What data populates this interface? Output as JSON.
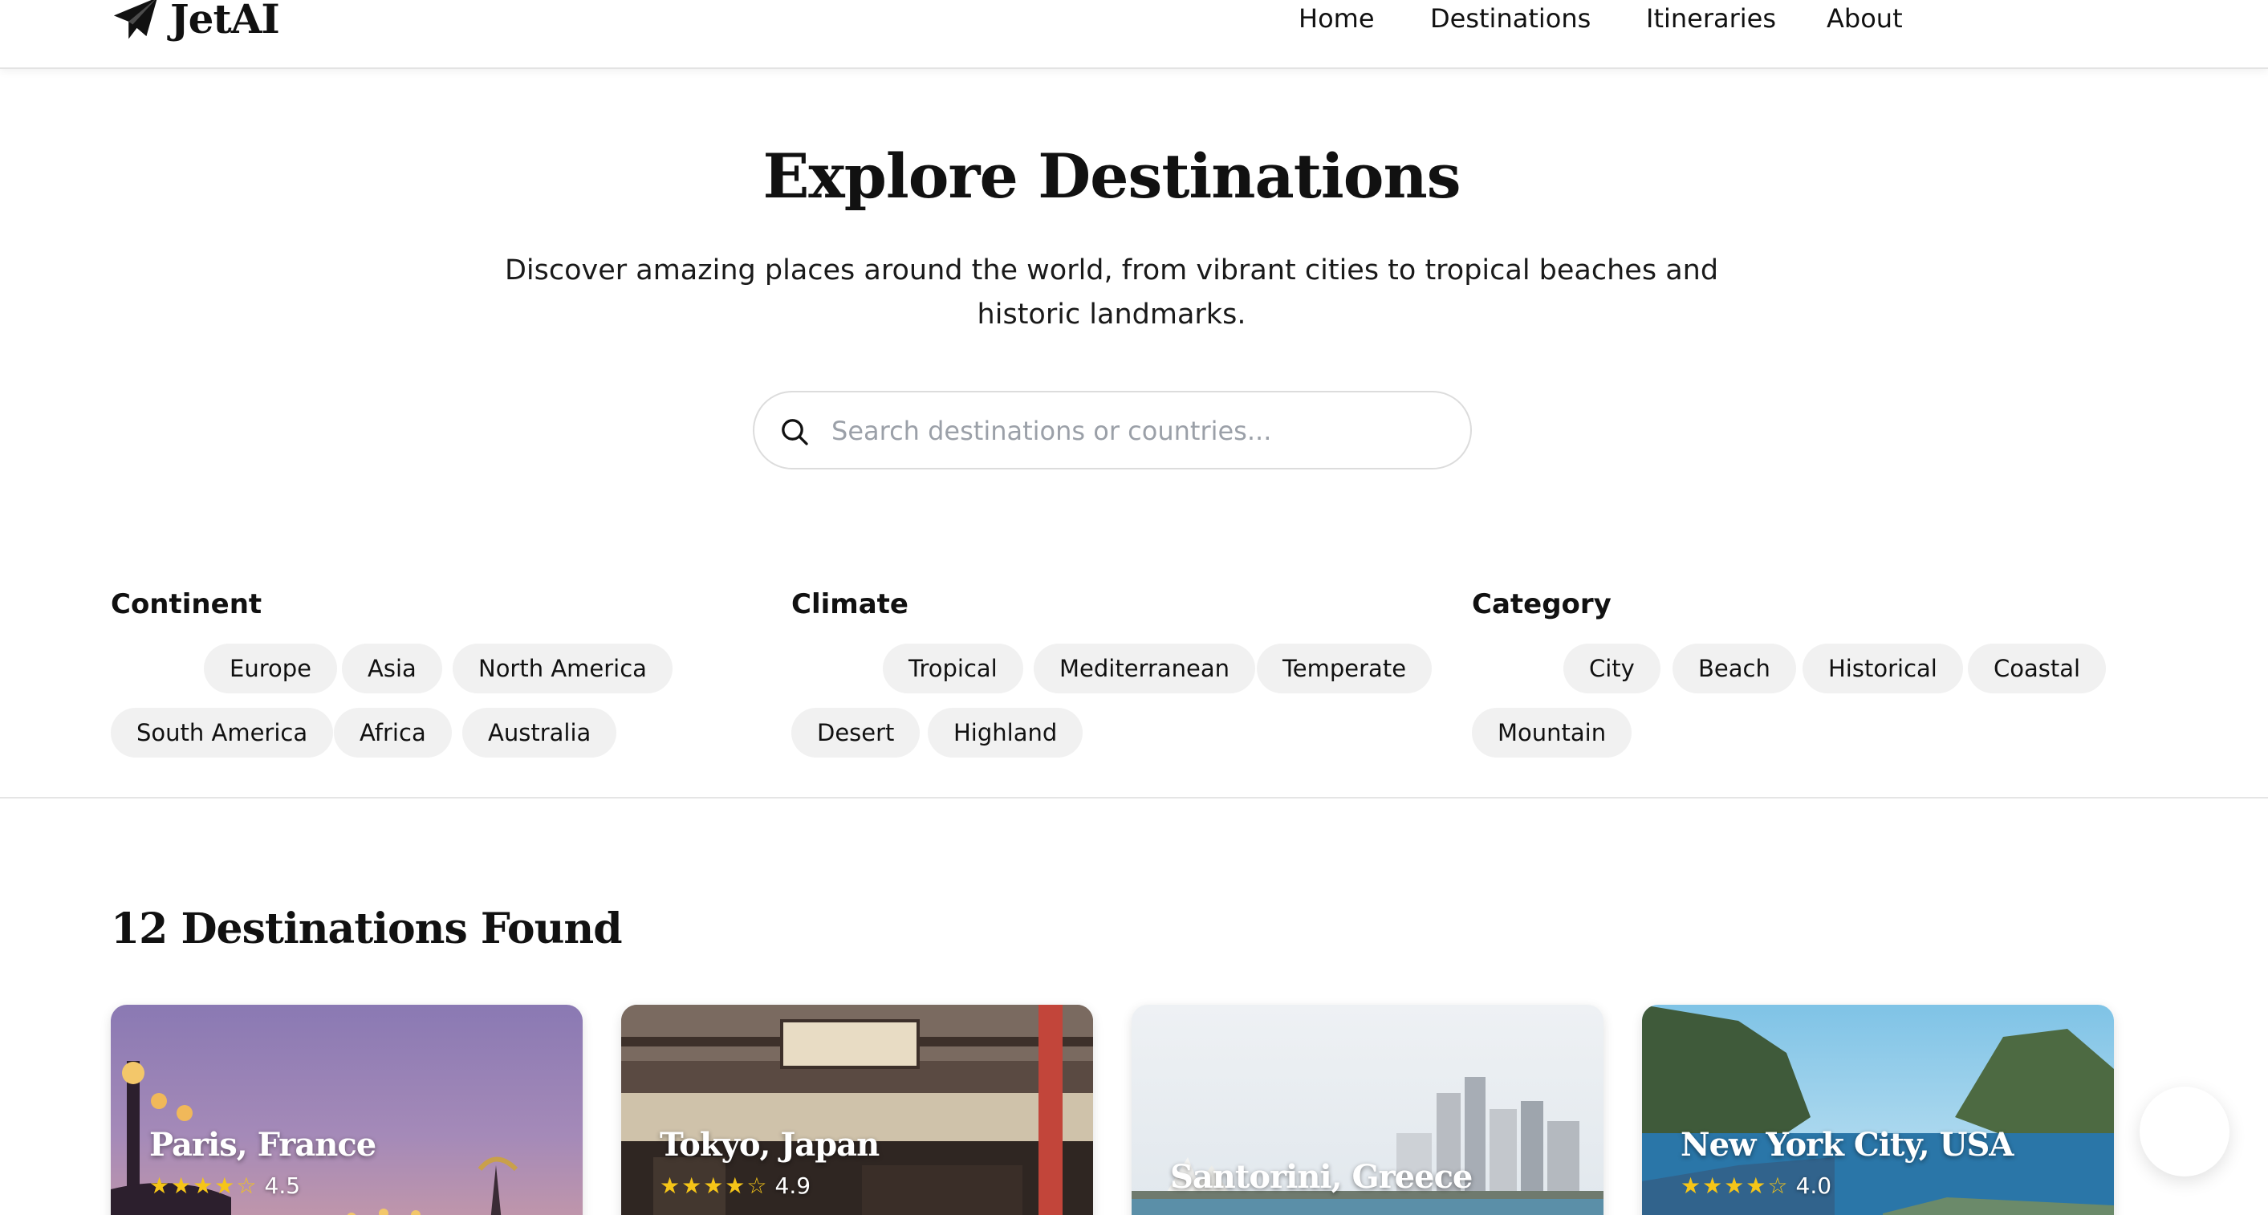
{
  "header": {
    "brand": "JetAI",
    "nav": [
      {
        "label": "Home"
      },
      {
        "label": "Destinations"
      },
      {
        "label": "Itineraries"
      },
      {
        "label": "About"
      }
    ]
  },
  "hero": {
    "title": "Explore Destinations",
    "subtitle": "Discover amazing places around the world, from vibrant cities to tropical beaches and historic landmarks.",
    "search_placeholder": "Search destinations or countries..."
  },
  "filters": {
    "continent": {
      "label": "Continent",
      "options": [
        "Europe",
        "Asia",
        "North America",
        "South America",
        "Africa",
        "Australia"
      ]
    },
    "climate": {
      "label": "Climate",
      "options": [
        "Tropical",
        "Mediterranean",
        "Temperate",
        "Desert",
        "Highland"
      ]
    },
    "category": {
      "label": "Category",
      "options": [
        "City",
        "Beach",
        "Historical",
        "Coastal",
        "Mountain"
      ]
    }
  },
  "results": {
    "title": "12 Destinations Found",
    "cards": [
      {
        "name": "Paris, France",
        "rating": "4.5",
        "stars": "★★★★☆"
      },
      {
        "name": "Tokyo, Japan",
        "rating": "4.9",
        "stars": "★★★★☆"
      },
      {
        "name": "Santorini, Greece",
        "rating": "",
        "stars": ""
      },
      {
        "name": "New York City, USA",
        "rating": "4.0",
        "stars": "★★★★☆"
      }
    ]
  },
  "icons": {
    "brand": "paper-plane-icon",
    "search": "search-icon"
  },
  "colors": {
    "chip_bg": "#f1f1f1",
    "star": "#f5c518",
    "divider": "#e5e5e5"
  }
}
